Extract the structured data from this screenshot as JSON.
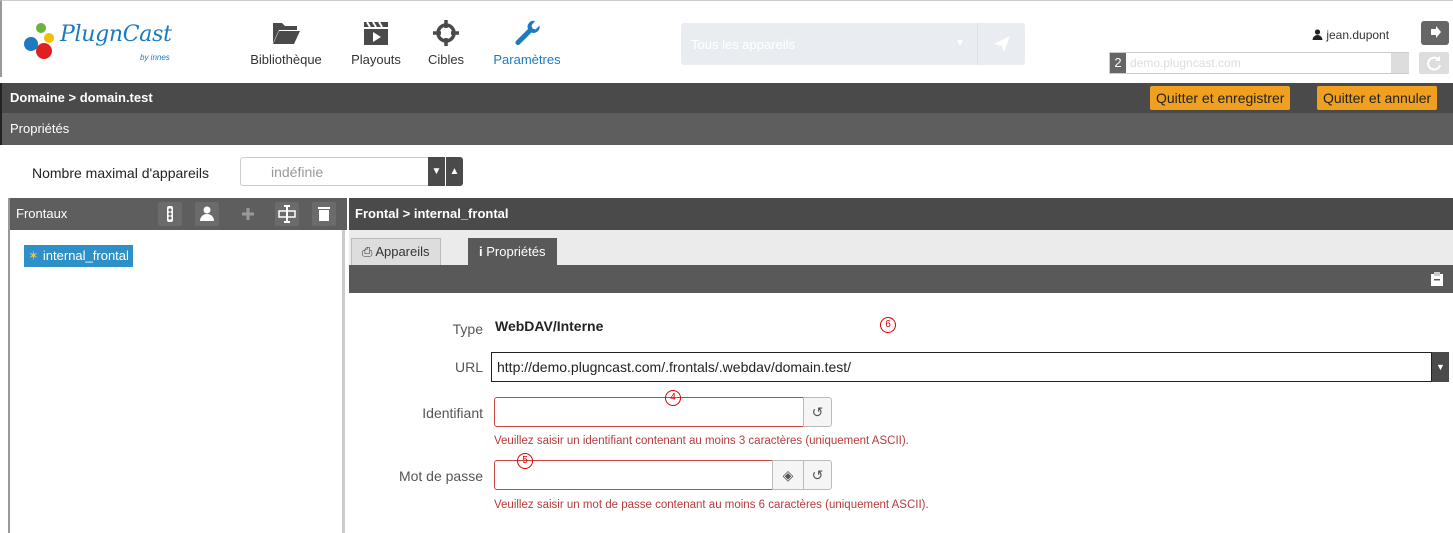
{
  "app": {
    "logo_text": "PlugnCast",
    "logo_sub": "by innes"
  },
  "nav": [
    {
      "label": "Bibliothèque",
      "icon": "folder-icon"
    },
    {
      "label": "Playouts",
      "icon": "clapperboard-icon"
    },
    {
      "label": "Cibles",
      "icon": "crosshair-icon"
    },
    {
      "label": "Paramètres",
      "icon": "wrench-icon",
      "active": true
    }
  ],
  "device_select": {
    "placeholder": "Tous les appareils"
  },
  "user": {
    "name": "jean.dupont"
  },
  "server": {
    "count": "2",
    "name": "demo.plugncast.com"
  },
  "domain_header": {
    "title": "Domaine > domain.test",
    "save_label": "Quitter et enregistrer",
    "cancel_label": "Quitter et annuler"
  },
  "properties_header": {
    "title": "Propriétés"
  },
  "max_devices": {
    "label": "Nombre maximal d'appareils",
    "value": "indéfinie"
  },
  "left_panel": {
    "title": "Frontaux",
    "items": [
      {
        "label": "internal_frontal"
      }
    ]
  },
  "right_panel": {
    "title": "Frontal > internal_frontal",
    "tabs": [
      {
        "label": "Appareils",
        "active": false
      },
      {
        "label": "Propriétés",
        "active": true
      }
    ]
  },
  "form": {
    "type_label": "Type",
    "type_value": "WebDAV/Interne",
    "url_label": "URL",
    "url_value": "http://demo.plugncast.com/.frontals/.webdav/domain.test/",
    "identifier_label": "Identifiant",
    "identifier_error": "Veuillez saisir un identifiant contenant au moins 3 caractères (uniquement ASCII).",
    "password_label": "Mot de passe",
    "password_error": "Veuillez saisir un mot de passe contenant au moins 6 caractères (uniquement ASCII)."
  },
  "markers": [
    "4",
    "5",
    "6"
  ],
  "colors": {
    "accent": "#1c7abf",
    "header_dark": "#4a4a4a",
    "orange": "#f0a020",
    "error": "#b73c3c",
    "tree_selected": "#2e90c8"
  }
}
